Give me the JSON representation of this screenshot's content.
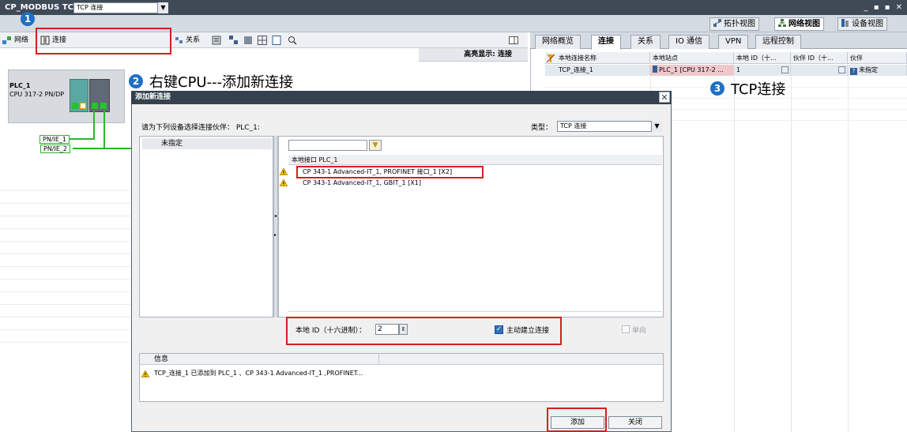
{
  "window": {
    "title": "CP_MODBUS TCP Client ▸ 设备和网络",
    "controls": "_ ▪ ▪ ✕"
  },
  "view_tabs": [
    {
      "label": "拓扑视图",
      "icon": "topology-icon"
    },
    {
      "label": "网络视图",
      "icon": "network-icon",
      "active": true
    },
    {
      "label": "设备视图",
      "icon": "device-icon"
    }
  ],
  "left_toolbar": {
    "network_label": "网络",
    "connection_label": "连接",
    "connection_select_value": "TCP 连接",
    "relation_label": "关系",
    "highlight_label": "高亮显示: 连接"
  },
  "device": {
    "name": "PLC_1",
    "type": "CPU 317-2 PN/DP",
    "net_labels": [
      "PN/IE_1",
      "PN/IE_2"
    ]
  },
  "right_panel": {
    "tabs": [
      "网络概览",
      "连接",
      "关系",
      "IO 通信",
      "VPN",
      "远程控制"
    ],
    "active_tab": "连接",
    "columns": [
      "本地连接名称",
      "本地站点",
      "本地 ID（十...",
      "伙伴 ID（十...",
      "伙伴"
    ],
    "row": {
      "name": "TCP_连接_1",
      "station": "PLC_1 [CPU 317-2 ...",
      "local_id": "1",
      "partner_id": "",
      "partner": "未指定"
    }
  },
  "dialog": {
    "title": "添加新连接",
    "prompt": "请为下列设备选择连接伙伴：   PLC_1:",
    "type_label": "类型：",
    "type_value": "TCP 连接",
    "partner_item": "未指定",
    "interface_header": "本地接口 PLC_1",
    "interfaces": [
      "CP 343-1 Advanced-IT_1, PROFINET 接口_1 [X2]",
      "CP 343-1 Advanced-IT_1, GBIT_1 [X1]"
    ],
    "local_id_label": "本地 ID（十六进制）：",
    "local_id_value": "2",
    "active_conn_label": "主动建立连接",
    "oneway_label": "单向",
    "info_title": "信息",
    "info_message": "TCP_连接_1 已添加到 PLC_1 、CP 343-1 Advanced-IT_1 ,PROFINET...",
    "add_button": "添加",
    "close_button": "关闭"
  },
  "annotations": {
    "step1_number": "1",
    "step2_number": "2",
    "step2_text": "右键CPU---添加新连接",
    "step3_number": "3",
    "step3_text": "TCP连接"
  },
  "colors": {
    "title_bar": "#3f4a57",
    "annotation_red": "#d32020",
    "badge_blue": "#1f6fc4",
    "net_green": "#2db52d"
  }
}
